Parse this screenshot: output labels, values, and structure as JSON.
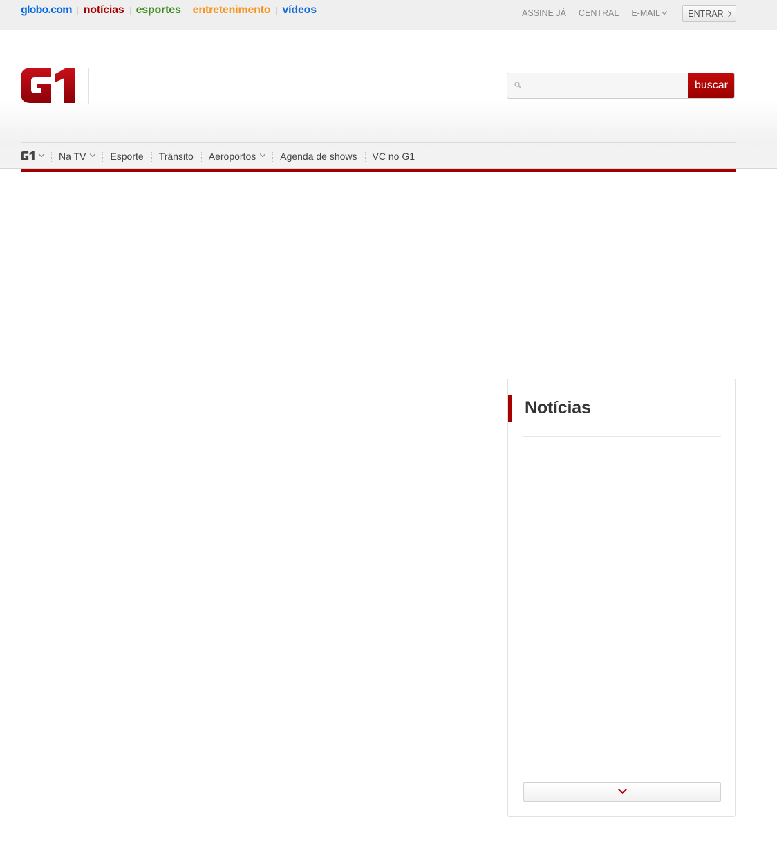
{
  "topbar": {
    "links": {
      "globo": "globo.com",
      "noticias": "notícias",
      "esportes": "esportes",
      "entretenimento": "entretenimento",
      "videos": "vídeos"
    },
    "user": {
      "assine": "ASSINE JÁ",
      "central": "CENTRAL",
      "email": "E-MAIL",
      "entrar": "ENTRAR"
    }
  },
  "header": {
    "logo_text": "G1",
    "search": {
      "placeholder": "",
      "value": "",
      "button_label": "buscar"
    }
  },
  "nav": {
    "items": [
      {
        "label": "G1",
        "dropdown": true
      },
      {
        "label": "Na TV",
        "dropdown": true
      },
      {
        "label": "Esporte",
        "dropdown": false
      },
      {
        "label": "Trânsito",
        "dropdown": false
      },
      {
        "label": "Aeroportos",
        "dropdown": true
      },
      {
        "label": "Agenda de shows",
        "dropdown": false
      },
      {
        "label": "VC no G1",
        "dropdown": false
      }
    ]
  },
  "widget": {
    "title": "Notícias"
  },
  "colors": {
    "brand_red": "#a80000",
    "globo_blue": "#0669de",
    "esportes_green": "#3b8a1d",
    "entretenimento_orange": "#f7941d",
    "videos_blue": "#1369d6"
  },
  "icons": [
    "search-icon",
    "chevron-down-icon",
    "chevron-right-icon",
    "g1-logo"
  ]
}
